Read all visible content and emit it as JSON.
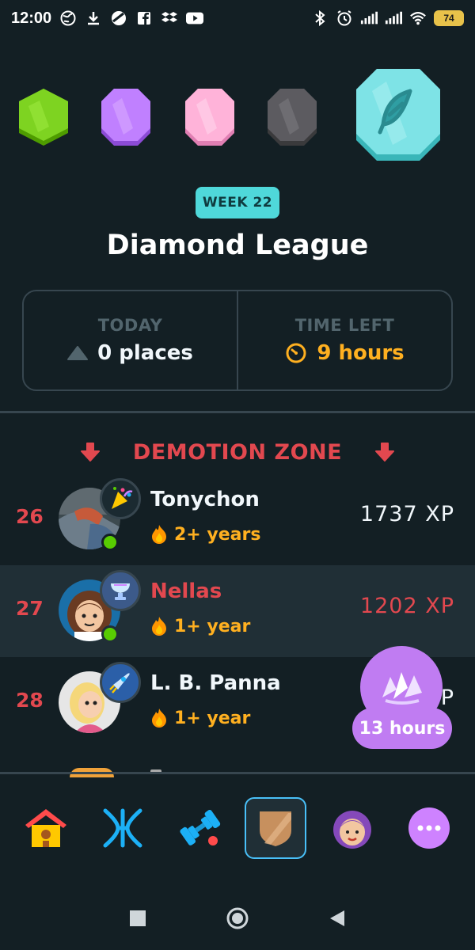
{
  "statusbar": {
    "time": "12:00",
    "battery": "74",
    "left_icons": [
      "globe-icon",
      "download-icon",
      "opera-icon",
      "facebook-icon",
      "dropbox-icon",
      "youtube-icon"
    ],
    "right_icons": [
      "bluetooth-icon",
      "alarm-icon",
      "signal-icon",
      "signal-icon",
      "wifi-icon",
      "battery-icon"
    ]
  },
  "league": {
    "week_label": "WEEK 22",
    "title": "Diamond League",
    "badges": [
      "emerald",
      "amethyst",
      "pearl",
      "obsidian",
      "diamond"
    ]
  },
  "stats": {
    "today_label": "TODAY",
    "today_value": "0 places",
    "timeleft_label": "TIME LEFT",
    "timeleft_value": "9 hours"
  },
  "zone_label": "DEMOTION ZONE",
  "rows": [
    {
      "rank": "26",
      "name": "Tonychon",
      "streak": "2+ years",
      "xp": "1737 XP",
      "is_me": false
    },
    {
      "rank": "27",
      "name": "Nellas",
      "streak": "1+ year",
      "xp": "1202 XP",
      "is_me": true
    },
    {
      "rank": "28",
      "name": "L. B. Panna",
      "streak": "1+ year",
      "xp": "P",
      "is_me": false
    }
  ],
  "chest": {
    "label": "13 hours"
  },
  "nav": {
    "items": [
      "home-icon",
      "alphabet-icon",
      "practice-icon",
      "leaderboard-icon",
      "profile-icon",
      "more-icon"
    ],
    "active": "leaderboard-icon"
  },
  "colors": {
    "background": "#131f24",
    "accent_red": "#e2484f",
    "accent_orange": "#ffb020",
    "accent_teal": "#4fd8da",
    "accent_purple": "#c07cf2",
    "nav_active": "#49c0f8"
  }
}
